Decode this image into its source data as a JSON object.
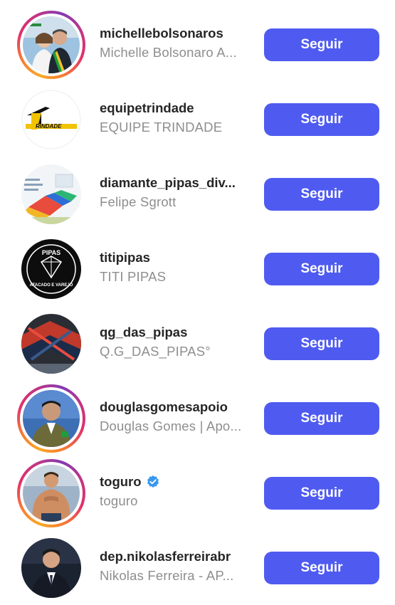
{
  "colors": {
    "button_bg": "#4f5bf0",
    "username": "#262626",
    "fullname": "#8e8e8e",
    "verified": "#3897f0"
  },
  "accounts": [
    {
      "username": "michellebolsonaros",
      "fullname": "Michelle Bolsonaro A...",
      "button": "Seguir",
      "story": true,
      "verified": false,
      "avatar_text": []
    },
    {
      "username": "equipetrindade",
      "fullname": "EQUIPE TRINDADE",
      "button": "Seguir",
      "story": false,
      "verified": false,
      "avatar_text": [
        "RINDADE"
      ]
    },
    {
      "username": "diamante_pipas_div...",
      "fullname": "Felipe Sgrott",
      "button": "Seguir",
      "story": false,
      "verified": false,
      "avatar_text": []
    },
    {
      "username": "titipipas",
      "fullname": "TITI PIPAS",
      "button": "Seguir",
      "story": false,
      "verified": false,
      "avatar_text": [
        "PIPAS",
        "ATACADO E VAREJO"
      ]
    },
    {
      "username": "qg_das_pipas",
      "fullname": "Q.G_DAS_PIPAS°",
      "button": "Seguir",
      "story": false,
      "verified": false,
      "avatar_text": []
    },
    {
      "username": "douglasgomesapoio",
      "fullname": "Douglas Gomes | Apo...",
      "button": "Seguir",
      "story": true,
      "verified": false,
      "avatar_text": []
    },
    {
      "username": "toguro",
      "fullname": "toguro",
      "button": "Seguir",
      "story": true,
      "verified": true,
      "avatar_text": []
    },
    {
      "username": "dep.nikolasferreirabr",
      "fullname": "Nikolas Ferreira - AP...",
      "button": "Seguir",
      "story": false,
      "verified": false,
      "avatar_text": []
    }
  ]
}
